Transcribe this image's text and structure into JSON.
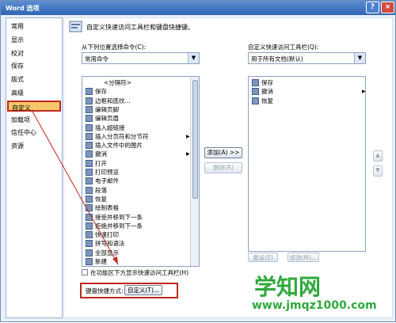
{
  "window": {
    "title": "Word 选项",
    "help": "?",
    "close": "×"
  },
  "sidebar": {
    "items": [
      "常用",
      "显示",
      "校对",
      "保存",
      "版式",
      "高级",
      "自定义",
      "加载项",
      "信任中心",
      "资源"
    ]
  },
  "header": {
    "text": "自定义快速访问工具栏和键盘快捷键。"
  },
  "left": {
    "label": "从下列位置选择命令(C):",
    "combo_value": "常用命令",
    "items": [
      {
        "label": "<分隔符>",
        "icon": "separator-icon"
      },
      {
        "label": "保存",
        "icon": "save-icon"
      },
      {
        "label": "边框和底纹...",
        "icon": "borders-icon"
      },
      {
        "label": "编辑页脚",
        "icon": "footer-icon"
      },
      {
        "label": "编辑页眉",
        "icon": "header-icon"
      },
      {
        "label": "插入超链接",
        "icon": "hyperlink-icon"
      },
      {
        "label": "插入分页符和分节符",
        "icon": "page-break-icon",
        "submenu": true
      },
      {
        "label": "插入文件中的图片",
        "icon": "picture-icon"
      },
      {
        "label": "撤消",
        "icon": "undo-icon",
        "submenu": true
      },
      {
        "label": "打开",
        "icon": "open-icon"
      },
      {
        "label": "打印预览",
        "icon": "print-preview-icon"
      },
      {
        "label": "电子邮件",
        "icon": "email-icon"
      },
      {
        "label": "段落",
        "icon": "paragraph-icon"
      },
      {
        "label": "恢复",
        "icon": "redo-icon"
      },
      {
        "label": "绘制表格",
        "icon": "draw-table-icon"
      },
      {
        "label": "接受并移到下一条",
        "icon": "accept-icon"
      },
      {
        "label": "拒绝并移到下一条",
        "icon": "reject-icon"
      },
      {
        "label": "快速打印",
        "icon": "quick-print-icon"
      },
      {
        "label": "拼写和语法",
        "icon": "spelling-icon"
      },
      {
        "label": "全部显示",
        "icon": "show-all-icon"
      },
      {
        "label": "新建",
        "icon": "new-icon"
      }
    ]
  },
  "right": {
    "label": "自定义快速访问工具栏(Q):",
    "combo_value": "用于所有文档(默认)",
    "items": [
      {
        "label": "保存",
        "icon": "save-icon"
      },
      {
        "label": "撤消",
        "icon": "undo-icon",
        "submenu": true
      },
      {
        "label": "恢复",
        "icon": "redo-icon"
      }
    ]
  },
  "buttons": {
    "add": "添加(A) >>",
    "remove": "删除(R)",
    "reset": "重设(E)",
    "modify": "修改(M)..."
  },
  "checkbox": {
    "label": "在功能区下方显示快速访问工具栏(H)"
  },
  "shortcut": {
    "label": "键盘快捷方式:",
    "button": "自定义(T)..."
  },
  "watermark": {
    "brand": "学知网",
    "url": "www.jmqz1000.com"
  },
  "colors": {
    "selected": "#f5c86b",
    "highlight_border": "#c0281c",
    "watermark": "#2fa83c"
  }
}
